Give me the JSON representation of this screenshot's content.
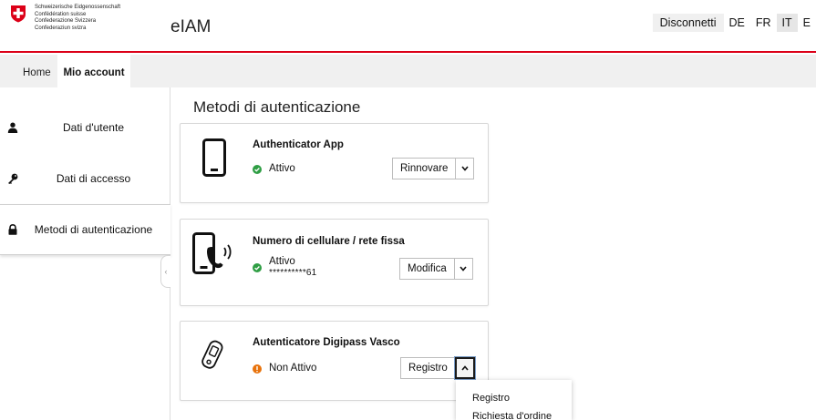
{
  "header": {
    "confederation_lines": [
      "Schweizerische Eidgenossenschaft",
      "Confédération suisse",
      "Confederazione Svizzera",
      "Confederaziun svizra"
    ],
    "app_title": "eIAM",
    "logout_label": "Disconnetti",
    "languages": [
      "DE",
      "FR",
      "IT",
      "E"
    ],
    "active_language": "IT"
  },
  "nav": {
    "tabs": [
      {
        "label": "Home",
        "active": false
      },
      {
        "label": "Mio account",
        "active": true
      }
    ]
  },
  "sidebar": {
    "items": [
      {
        "label": "Dati d'utente",
        "icon": "user-icon"
      },
      {
        "label": "Dati di accesso",
        "icon": "key-icon"
      },
      {
        "label": "Metodi di autenticazione",
        "icon": "lock-icon",
        "active": true
      }
    ],
    "collapse_glyph": "‹"
  },
  "main": {
    "title": "Metodi di autenticazione",
    "methods": [
      {
        "name": "Authenticator App",
        "icon": "smartphone-icon",
        "status": "Attivo",
        "status_type": "active",
        "action_label": "Rinnovare"
      },
      {
        "name": "Numero di cellulare / rete fissa",
        "icon": "phone-call-icon",
        "status": "Attivo",
        "masked_number": "**********61",
        "status_type": "active",
        "action_label": "Modifica"
      },
      {
        "name": "Autenticatore Digipass Vasco",
        "icon": "digipass-token-icon",
        "status": "Non Attivo",
        "status_type": "inactive",
        "action_label": "Registro"
      }
    ]
  },
  "dropdown": {
    "items": [
      "Registro",
      "Richiesta d'ordine"
    ]
  },
  "colors": {
    "brand_red": "#dc0018",
    "active_green": "#2f9e44",
    "inactive_orange": "#e8730c"
  }
}
